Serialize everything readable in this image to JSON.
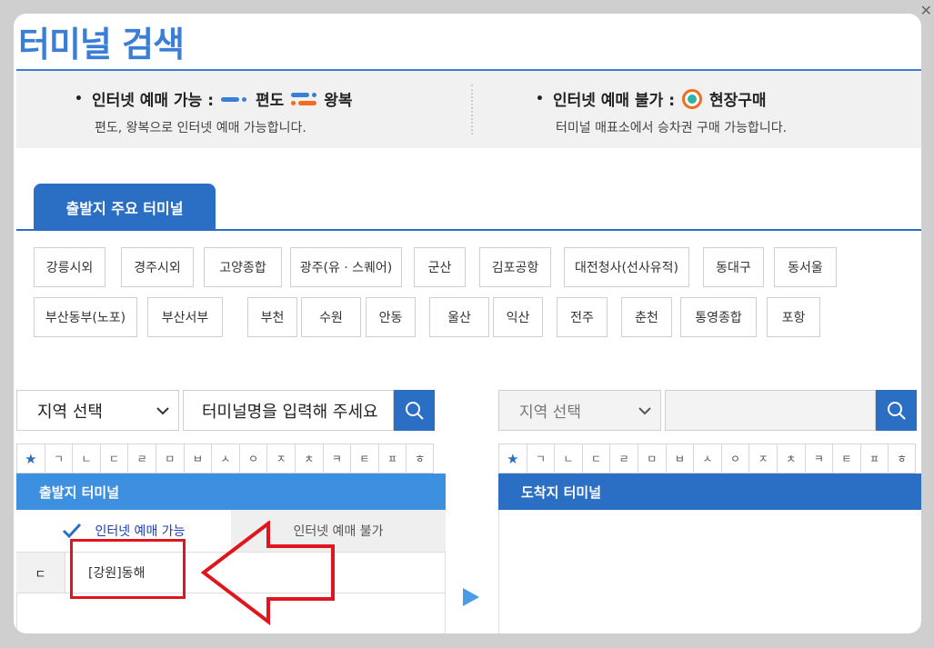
{
  "window": {
    "close_icon": "close-icon"
  },
  "page": {
    "title": "터미널 검색"
  },
  "info": {
    "online_label": "인터넷 예매 가능 :",
    "oneway_label": "편도",
    "roundtrip_label": "왕복",
    "online_desc": "편도, 왕복으로 인터넷 예매 가능합니다.",
    "offline_label": "인터넷 예매 불가 :",
    "onsite_label": "현장구매",
    "offline_desc": "터미널 매표소에서 승차권 구매 가능합니다."
  },
  "major_tab": {
    "label": "출발지 주요 터미널"
  },
  "major_terminals": [
    "강릉시외",
    "경주시외",
    "고양종합",
    "광주(유 · 스퀘어)",
    "군산",
    "김포공항",
    "대전청사(선사유적)",
    "동대구",
    "동서울",
    "부산동부(노포)",
    "부산서부",
    "부천",
    "수원",
    "안동",
    "울산",
    "익산",
    "전주",
    "춘천",
    "통영종합",
    "포항"
  ],
  "departure": {
    "region_select": "지역 선택",
    "search_placeholder": "터미널명을 입력해 주세요",
    "header": "출발지 터미널",
    "tab_online": "인터넷 예매 가능",
    "tab_offline": "인터넷 예매 불가",
    "list": [
      {
        "consonant": "ㄷ",
        "terminal": "[강원]동해"
      }
    ]
  },
  "arrival": {
    "region_select": "지역 선택",
    "search_placeholder": "",
    "header": "도착지 터미널"
  },
  "consonants": [
    "★",
    "ㄱ",
    "ㄴ",
    "ㄷ",
    "ㄹ",
    "ㅁ",
    "ㅂ",
    "ㅅ",
    "ㅇ",
    "ㅈ",
    "ㅊ",
    "ㅋ",
    "ㅌ",
    "ㅍ",
    "ㅎ"
  ],
  "colors": {
    "primary": "#3a7fd5",
    "dark_blue": "#2a6fc3",
    "orange": "#f26b21",
    "teal": "#2bb3a3",
    "annotation_red": "#e0161e"
  }
}
